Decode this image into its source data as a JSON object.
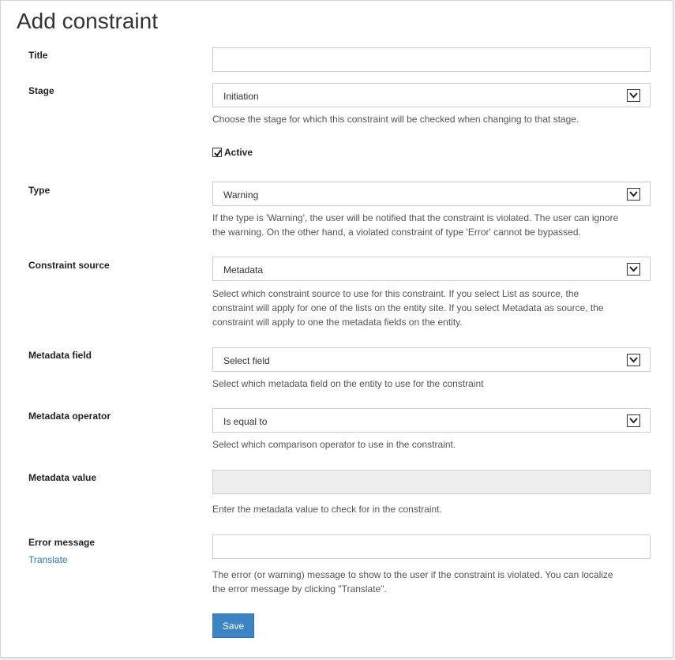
{
  "page": {
    "title": "Add constraint"
  },
  "fields": {
    "title": {
      "label": "Title",
      "value": ""
    },
    "stage": {
      "label": "Stage",
      "value": "Initiation",
      "help": "Choose the stage for which this constraint will be checked when changing to that stage."
    },
    "active": {
      "label": "Active",
      "checked": true
    },
    "type": {
      "label": "Type",
      "value": "Warning",
      "help_line1": "If the type is 'Warning', the user will be notified that the constraint is violated. The user can ignore",
      "help_line2": "the warning. On the other hand, a violated constraint of type 'Error' cannot be bypassed."
    },
    "constraint_source": {
      "label": "Constraint source",
      "value": "Metadata",
      "help_line1": "Select which constraint source to use for this constraint. If you select List as source, the",
      "help_line2": "constraint will apply for one of the lists on the entity site. If you select Metadata as source, the",
      "help_line3": "constraint will apply to one the metadata fields on the entity."
    },
    "metadata_field": {
      "label": "Metadata field",
      "value": "Select field",
      "help": "Select which metadata field on the entity to use for the constraint"
    },
    "metadata_operator": {
      "label": "Metadata operator",
      "value": "Is equal to",
      "help": "Select which comparison operator to use in the constraint."
    },
    "metadata_value": {
      "label": "Metadata value",
      "value": "",
      "help": "Enter the metadata value to check for in the constraint."
    },
    "error_message": {
      "label": "Error message",
      "translate_link": "Translate",
      "value": "",
      "help_line1": "The error (or warning) message to show to the user if the constraint is violated. You can localize",
      "help_line2": "the error message by clicking \"Translate\"."
    }
  },
  "actions": {
    "save_label": "Save"
  },
  "colors": {
    "primary": "#3c84c4",
    "link": "#2a7ab8"
  },
  "icons": {
    "select_caret": "chevron-down-icon",
    "checkbox": "checkmark-icon"
  }
}
